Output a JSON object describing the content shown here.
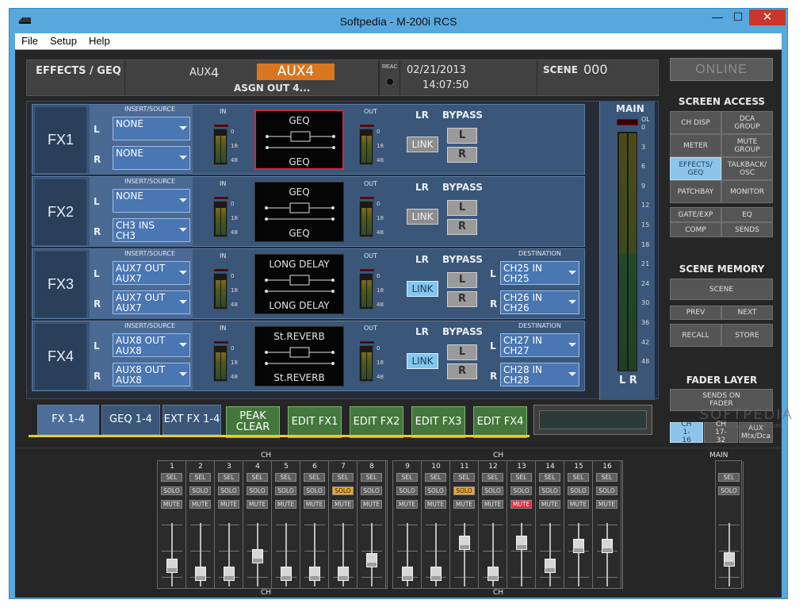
{
  "window": {
    "title": "Softpedia - M-200i RCS",
    "min_label": "—",
    "max_label": "☐",
    "close_label": "✕"
  },
  "menu": [
    "File",
    "Setup",
    "Help"
  ],
  "header": {
    "screen": "EFFECTS / GEQ",
    "aux_prefix": "AUX",
    "aux_num": "4",
    "aux_name": "AUX4",
    "assign": "ASGN OUT 4...",
    "reac": "REAC",
    "date": "02/21/2013",
    "time": "14:07:50",
    "scene_label": "SCENE",
    "scene_num": "000"
  },
  "fx_labels": {
    "insert_source": "INSERT/SOURCE",
    "in": "IN",
    "out": "OUT",
    "lr": "LR",
    "bypass": "BYPASS",
    "link": "LINK",
    "l": "L",
    "r": "R",
    "destination": "DESTINATION",
    "ticks": [
      "0",
      "18",
      "48"
    ]
  },
  "fx": [
    {
      "name": "FX1",
      "src_l": "NONE",
      "src_r": "NONE",
      "disp_top": "GEQ",
      "disp_bot": "GEQ",
      "link": false,
      "selected": true
    },
    {
      "name": "FX2",
      "src_l": "NONE",
      "src_r": "CH3 INS\nCH3",
      "disp_top": "GEQ",
      "disp_bot": "GEQ",
      "link": false,
      "selected": false
    },
    {
      "name": "FX3",
      "src_l": "AUX7 OUT\nAUX7",
      "src_r": "AUX7 OUT\nAUX7",
      "disp_top": "LONG DELAY",
      "disp_bot": "LONG DELAY",
      "link": true,
      "dest_l": "CH25 IN\nCH25",
      "dest_r": "CH26 IN\nCH26"
    },
    {
      "name": "FX4",
      "src_l": "AUX8 OUT\nAUX8",
      "src_r": "AUX8 OUT\nAUX8",
      "disp_top": "St.REVERB",
      "disp_bot": "St.REVERB",
      "link": true,
      "dest_l": "CH27 IN\nCH27",
      "dest_r": "CH28 IN\nCH28"
    }
  ],
  "main_meter": {
    "label": "MAIN",
    "lr": "L R",
    "scale": [
      "OL",
      "0",
      "3",
      "6",
      "9",
      "12",
      "15",
      "18",
      "21",
      "24",
      "30",
      "36",
      "42",
      "48"
    ]
  },
  "right_panel": {
    "online": "ONLINE",
    "screen_access": "SCREEN ACCESS",
    "buttons": [
      [
        "CH DISP",
        "DCA GROUP"
      ],
      [
        "METER",
        "MUTE GROUP"
      ],
      [
        "EFFECTS/ GEQ",
        "TALKBACK/ OSC"
      ],
      [
        "PATCHBAY",
        "MONITOR"
      ]
    ],
    "buttons2": [
      [
        "GATE/EXP",
        "EQ"
      ],
      [
        "COMP",
        "SENDS"
      ]
    ],
    "scene_memory": "SCENE MEMORY",
    "scene": "SCENE",
    "prev": "PREV",
    "next": "NEXT",
    "recall": "RECALL",
    "store": "STORE",
    "fader_layer": "FADER LAYER",
    "sends_on_fader": "SENDS ON FADER",
    "layers": [
      "CH 1-16",
      "CH 17-32",
      "AUX Mtx/Dca"
    ]
  },
  "tabs": [
    "FX 1-4",
    "GEQ 1-4",
    "EXT FX 1-4"
  ],
  "action_buttons": [
    "PEAK CLEAR",
    "EDIT FX1",
    "EDIT FX2",
    "EDIT FX3",
    "EDIT FX4"
  ],
  "mixer": {
    "ch_label": "CH",
    "main_label": "MAIN",
    "sel": "SEL",
    "solo": "SOLO",
    "mute": "MUTE",
    "group1": [
      {
        "num": "1",
        "fader": 0.28,
        "solo": false,
        "mute": false
      },
      {
        "num": "2",
        "fader": 0.12,
        "solo": false,
        "mute": false
      },
      {
        "num": "3",
        "fader": 0.12,
        "solo": false,
        "mute": false
      },
      {
        "num": "4",
        "fader": 0.47,
        "solo": false,
        "mute": false
      },
      {
        "num": "5",
        "fader": 0.12,
        "solo": false,
        "mute": false
      },
      {
        "num": "6",
        "fader": 0.12,
        "solo": false,
        "mute": false
      },
      {
        "num": "7",
        "fader": 0.12,
        "solo": true,
        "mute": false
      },
      {
        "num": "8",
        "fader": 0.38,
        "solo": false,
        "mute": false
      }
    ],
    "group2": [
      {
        "num": "9",
        "fader": 0.12,
        "solo": false,
        "mute": false
      },
      {
        "num": "10",
        "fader": 0.12,
        "solo": false,
        "mute": false
      },
      {
        "num": "11",
        "fader": 0.75,
        "solo": true,
        "mute": false
      },
      {
        "num": "12",
        "fader": 0.12,
        "solo": false,
        "mute": false
      },
      {
        "num": "13",
        "fader": 0.75,
        "solo": false,
        "mute": true
      },
      {
        "num": "14",
        "fader": 0.28,
        "solo": false,
        "mute": false
      },
      {
        "num": "15",
        "fader": 0.68,
        "solo": false,
        "mute": false
      },
      {
        "num": "16",
        "fader": 0.68,
        "solo": false,
        "mute": false
      }
    ],
    "main_fader": 0.4
  },
  "watermark": "SOFTPEDIA",
  "watermark_url": "www.softpedia.com",
  "colors": {
    "aux": "#d9761f",
    "link_on": "#83c7ef",
    "solo_on": "#f0a52c",
    "mute_on": "#e0283b",
    "fx_selected": "#d2283a"
  }
}
